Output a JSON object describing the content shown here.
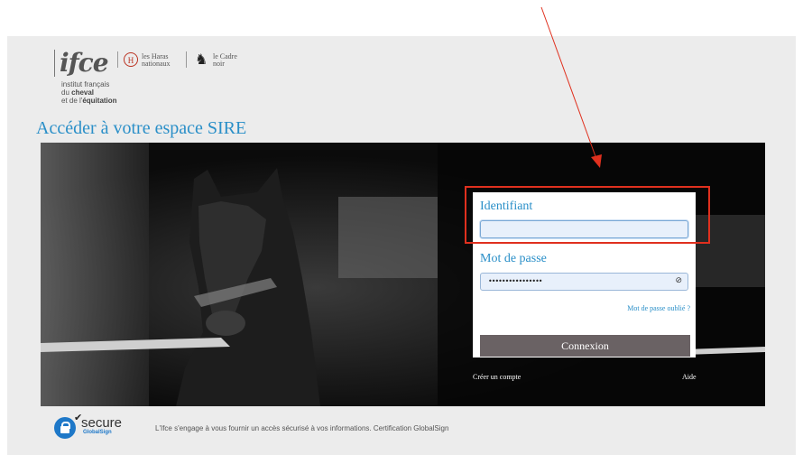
{
  "brand": {
    "logo_text": "ifce",
    "subtitle_line1": "institut français",
    "subtitle_line2_prefix": "du ",
    "subtitle_line2_bold": "cheval",
    "subtitle_line3_prefix": "et de l'",
    "subtitle_line3_bold": "équitation",
    "partner1_line1": "les Haras",
    "partner1_line2": "nationaux",
    "partner2_line1": "le Cadre",
    "partner2_line2": "noir"
  },
  "page_title": "Accéder à votre espace SIRE",
  "login": {
    "username_label": "Identifiant",
    "username_value": "",
    "password_label": "Mot de passe",
    "password_mask": "••••••••••••••••",
    "forgot_link": "Mot de passe oublié ?",
    "submit_label": "Connexion",
    "create_account": "Créer un compte",
    "help": "Aide"
  },
  "footer": {
    "secure_word": "secure",
    "secure_sub": "GlobalSign",
    "text": "L'Ifce s'engage à vous fournir un accès sécurisé à vos informations. Certification GlobalSign"
  },
  "colors": {
    "accent": "#2a8fc8",
    "highlight": "#e0301e",
    "button": "#6a6264"
  }
}
